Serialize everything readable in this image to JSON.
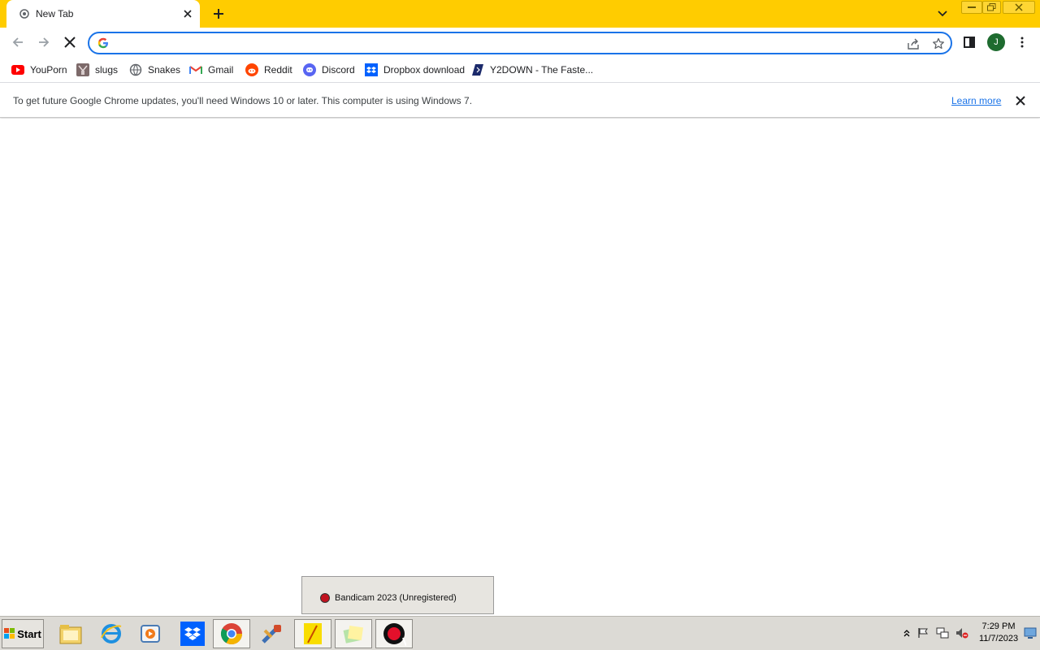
{
  "tab": {
    "title": "New Tab"
  },
  "omnibox": {
    "value": "",
    "placeholder": ""
  },
  "profile": {
    "initial": "J"
  },
  "bookmarks": [
    {
      "label": "YouPorn",
      "icon": "youtube-play-icon"
    },
    {
      "label": "slugs",
      "icon": "image-thumbnail-icon"
    },
    {
      "label": "Snakes",
      "icon": "globe-icon"
    },
    {
      "label": "Gmail",
      "icon": "gmail-icon"
    },
    {
      "label": "Reddit",
      "icon": "reddit-icon"
    },
    {
      "label": "Discord",
      "icon": "discord-icon"
    },
    {
      "label": "Dropbox download",
      "icon": "dropbox-icon"
    },
    {
      "label": "Y2DOWN - The Faste...",
      "icon": "y2down-icon"
    }
  ],
  "infobar": {
    "message": "To get future Google Chrome updates, you'll need Windows 10 or later. This computer is using Windows 7.",
    "link": "Learn more"
  },
  "preview": {
    "label": "Bandicam 2023 (Unregistered)"
  },
  "taskbar": {
    "start_label": "Start",
    "apps": [
      "file-explorer-icon",
      "internet-explorer-icon",
      "media-player-icon",
      "dropbox-icon",
      "chrome-icon",
      "tools-icon",
      "notepad-icon",
      "sticky-notes-icon",
      "bandicam-icon"
    ]
  },
  "clock": {
    "time": "7:29 PM",
    "date": "11/7/2023"
  },
  "colors": {
    "tab_strip": "#ffcc00",
    "omnibox_border": "#1a73e8",
    "link": "#1a73e8",
    "avatar": "#1e6b2f",
    "taskbar": "#dcdad5"
  }
}
